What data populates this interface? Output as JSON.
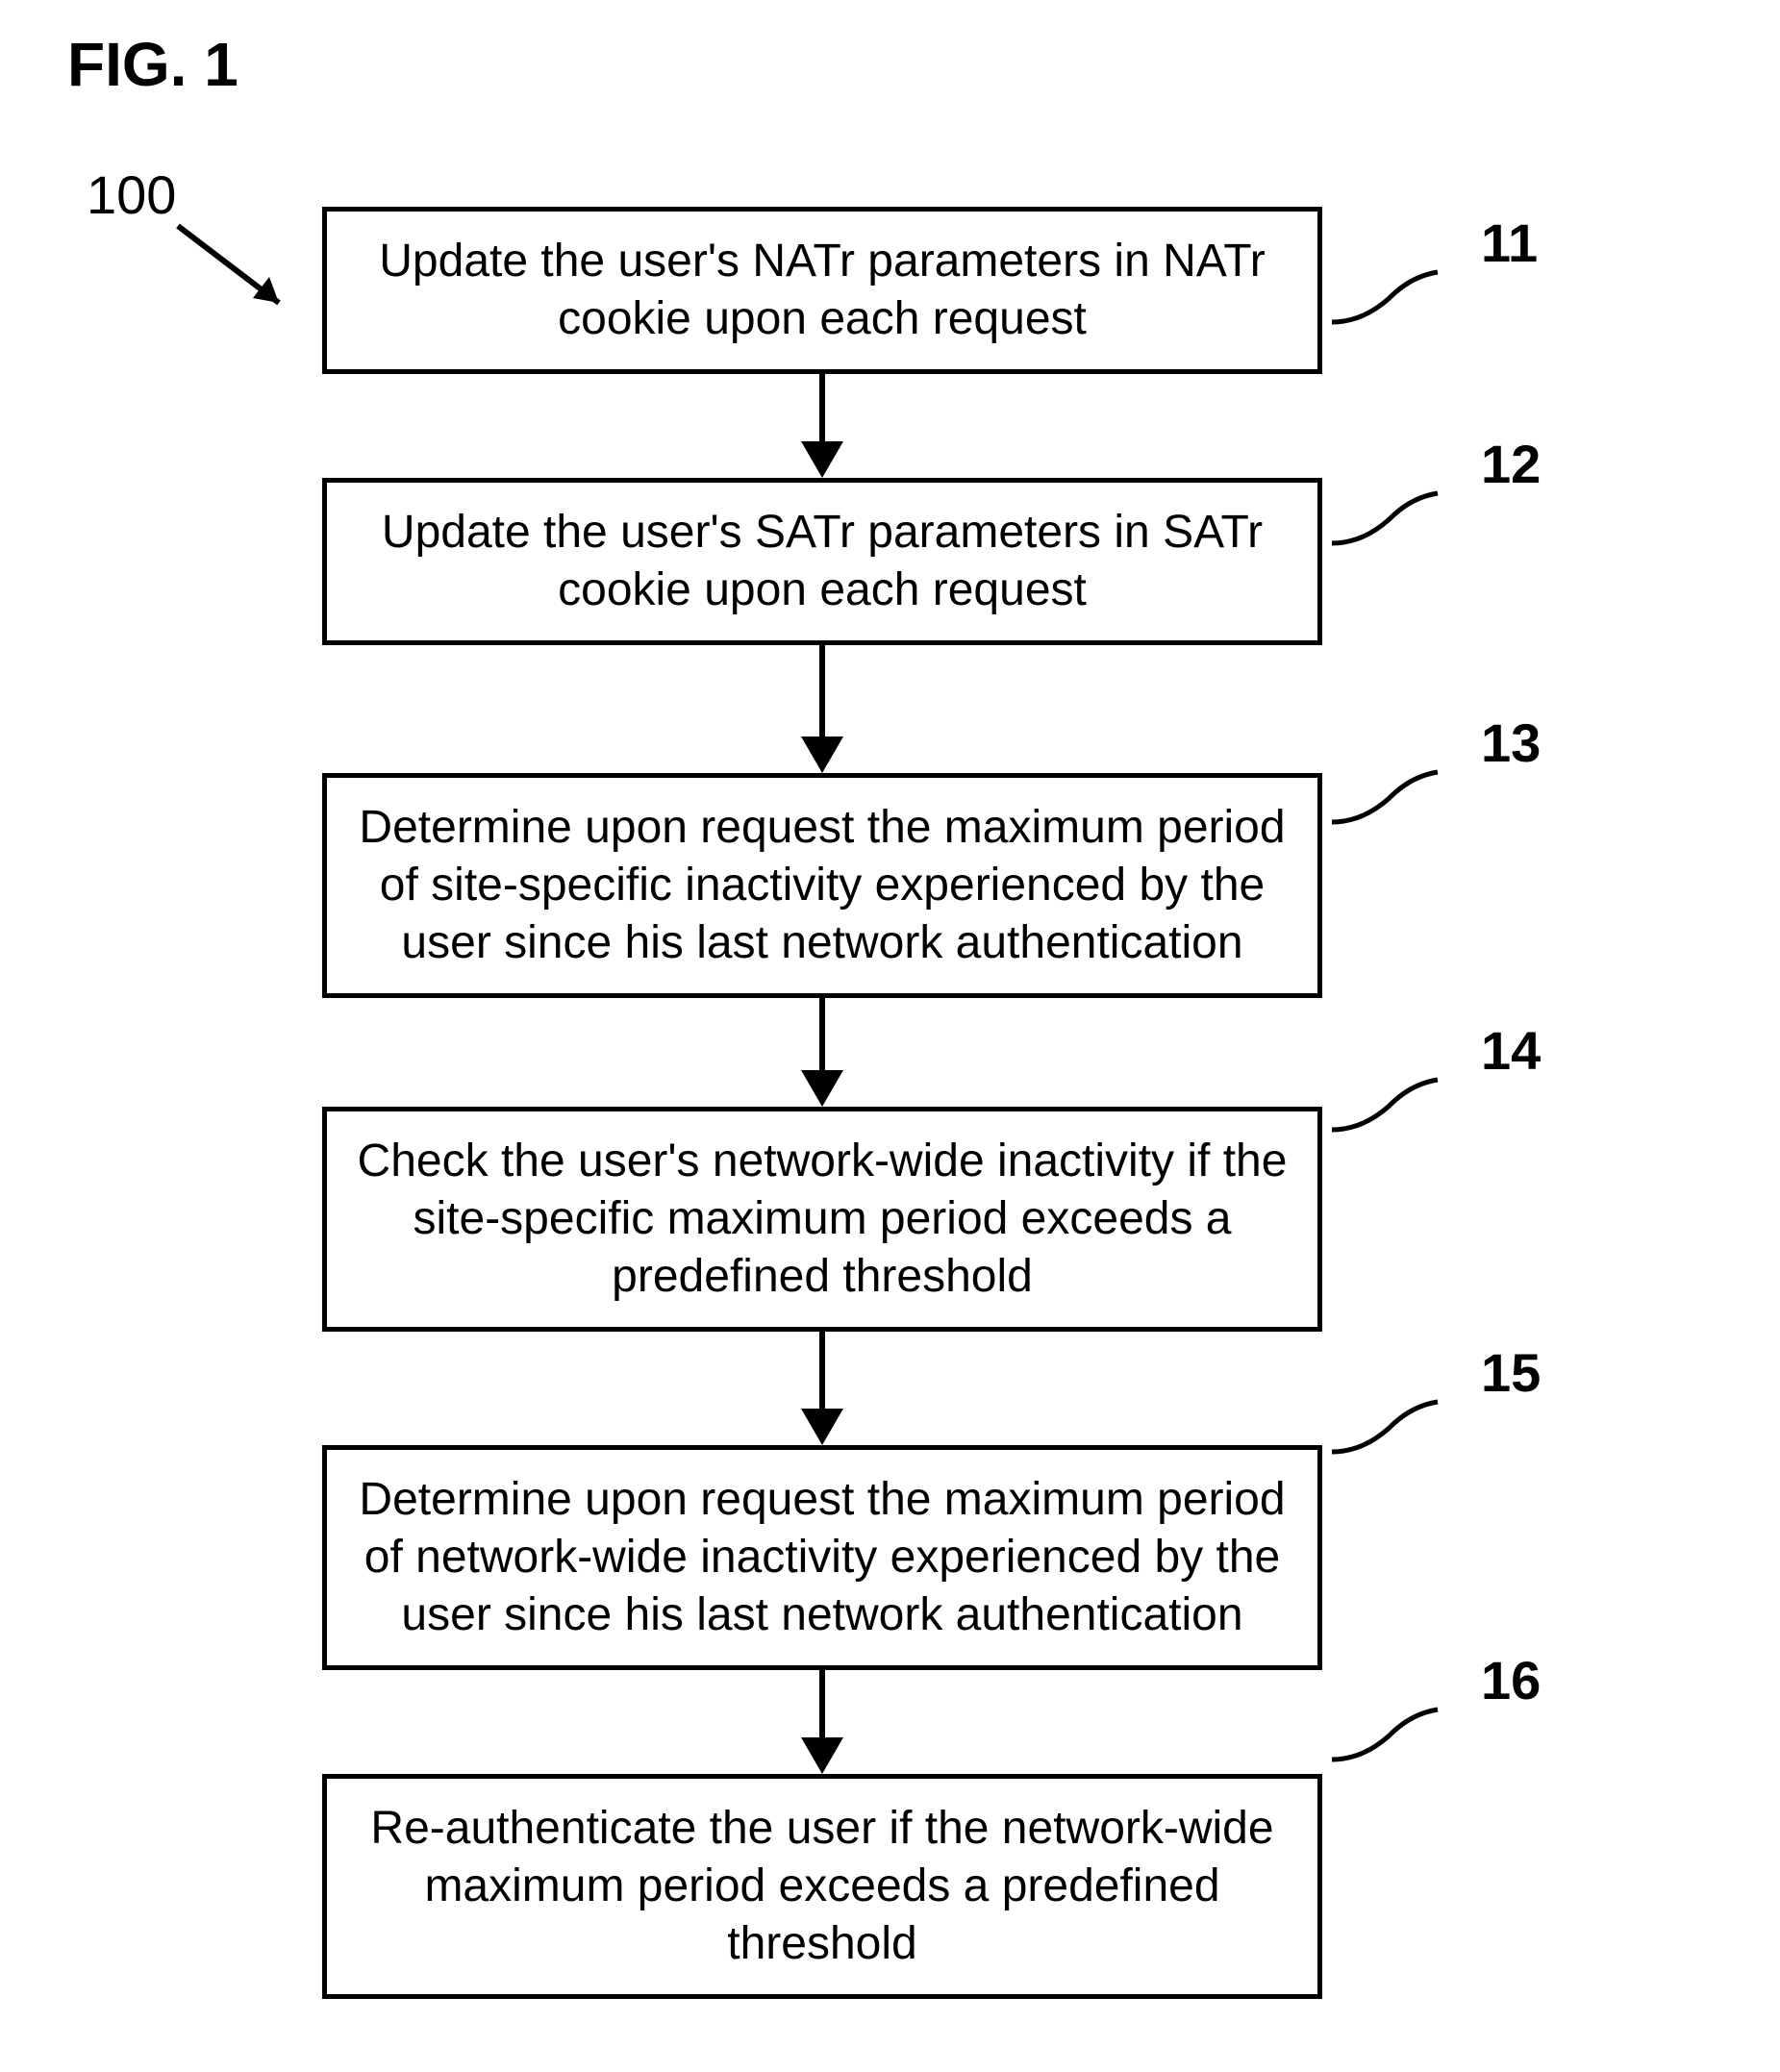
{
  "figure_label": "FIG. 1",
  "reference_number": "100",
  "steps": [
    {
      "num": "11",
      "text": "Update the user's NATr parameters in NATr cookie upon each request"
    },
    {
      "num": "12",
      "text": "Update the user's SATr parameters in SATr cookie upon each request"
    },
    {
      "num": "13",
      "text": "Determine upon request the maximum period of site-specific inactivity experienced by the user since his last network authentication"
    },
    {
      "num": "14",
      "text": "Check the user's network-wide inactivity if the site-specific maximum period exceeds a predefined threshold"
    },
    {
      "num": "15",
      "text": "Determine upon request the maximum period of network-wide inactivity experienced by the user since his last network authentication"
    },
    {
      "num": "16",
      "text": "Re-authenticate the user if the network-wide maximum period exceeds a predefined threshold"
    }
  ]
}
